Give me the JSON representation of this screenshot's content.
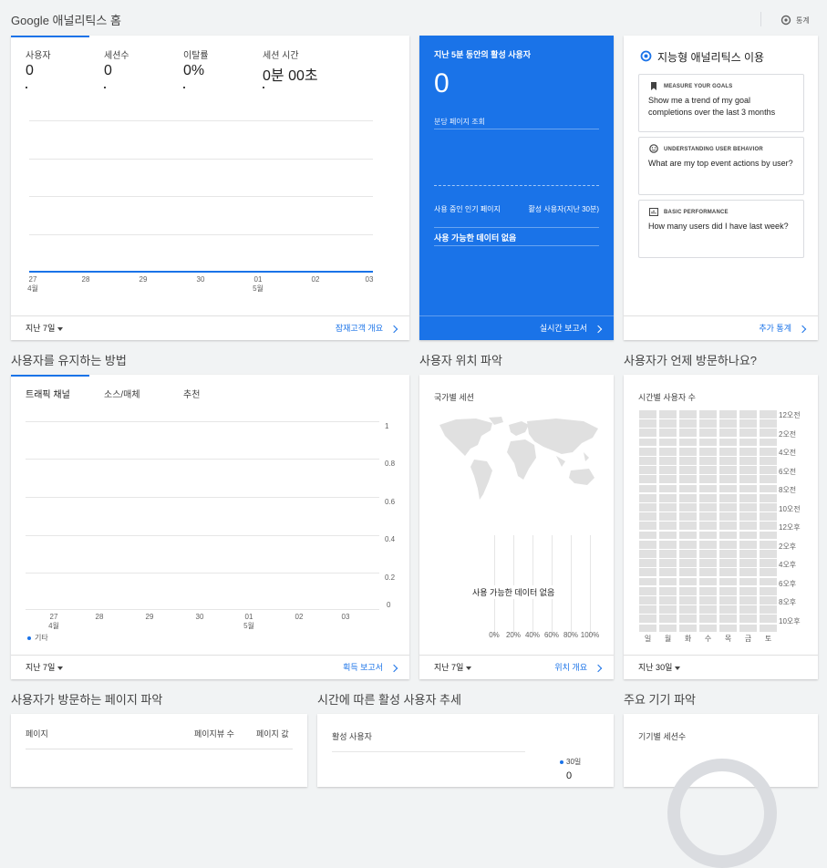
{
  "header": {
    "title": "Google 애널리틱스 홈",
    "insights_label": "통계"
  },
  "overview": {
    "metrics": [
      {
        "label": "사용자",
        "value": "0"
      },
      {
        "label": "세션수",
        "value": "0"
      },
      {
        "label": "이탈률",
        "value": "0%"
      },
      {
        "label": "세션 시간",
        "value": "0분 00초"
      }
    ],
    "x_ticks": [
      {
        "day": "27",
        "month": "4월"
      },
      {
        "day": "28",
        "month": ""
      },
      {
        "day": "29",
        "month": ""
      },
      {
        "day": "30",
        "month": ""
      },
      {
        "day": "01",
        "month": "5월"
      },
      {
        "day": "02",
        "month": ""
      },
      {
        "day": "03",
        "month": ""
      }
    ],
    "date_range": "지난 7일",
    "link": "잠재고객 개요"
  },
  "realtime": {
    "title": "지난 5분 동안의 활성 사용자",
    "value": "0",
    "pageviews_label": "분당 페이지 조회",
    "col_pages": "사용 중인 인기 페이지",
    "col_active": "활성 사용자(지난 30분)",
    "no_data": "사용 가능한 데이터 없음",
    "link": "실시간 보고서"
  },
  "intelligence": {
    "title": "지능형 애널리틱스 이용",
    "cards": [
      {
        "icon": "bookmark-icon",
        "category": "MEASURE YOUR GOALS",
        "question": "Show me a trend of my goal completions over the last 3 months"
      },
      {
        "icon": "smiley-icon",
        "category": "UNDERSTANDING USER BEHAVIOR",
        "question": "What are my top event actions by user?"
      },
      {
        "icon": "chart-box-icon",
        "category": "BASIC PERFORMANCE",
        "question": "How many users did I have last week?"
      }
    ],
    "link": "추가 통계"
  },
  "sections": {
    "retain": "사용자를 유지하는 방법",
    "location": "사용자 위치 파악",
    "when": "사용자가 언제 방문하나요?",
    "pages": "사용자가 방문하는 페이지 파악",
    "active_trend": "시간에 따른 활성 사용자 추세",
    "devices": "주요 기기 파악"
  },
  "acquisition": {
    "tabs": [
      "트래픽 채널",
      "소스/매체",
      "추천"
    ],
    "y_ticks": [
      "1",
      "0.8",
      "0.6",
      "0.4",
      "0.2",
      "0"
    ],
    "x_ticks": [
      {
        "day": "27",
        "month": "4월"
      },
      {
        "day": "28",
        "month": ""
      },
      {
        "day": "29",
        "month": ""
      },
      {
        "day": "30",
        "month": ""
      },
      {
        "day": "01",
        "month": "5월"
      },
      {
        "day": "02",
        "month": ""
      },
      {
        "day": "03",
        "month": ""
      }
    ],
    "legend": "기타",
    "date_range": "지난 7일",
    "link": "획득 보고서"
  },
  "geo": {
    "label": "국가별 세션",
    "no_data": "사용 가능한 데이터 없음",
    "pct_ticks": [
      "0%",
      "20%",
      "40%",
      "60%",
      "80%",
      "100%"
    ],
    "date_range": "지난 7일",
    "link": "위치 개요"
  },
  "time": {
    "label": "시간별 사용자 수",
    "hours": [
      "12오전",
      "2오전",
      "4오전",
      "6오전",
      "8오전",
      "10오전",
      "12오후",
      "2오후",
      "4오후",
      "6오후",
      "8오후",
      "10오후"
    ],
    "days": [
      "일",
      "월",
      "화",
      "수",
      "목",
      "금",
      "토"
    ],
    "date_range": "지난 30일"
  },
  "pages_table": {
    "col_page": "페이지",
    "col_views": "페이지뷰 수",
    "col_value": "페이지 값"
  },
  "active_users": {
    "label": "활성 사용자",
    "legend": "30일",
    "value": "0"
  },
  "devices": {
    "label": "기기별 세션수"
  },
  "colors": {
    "accent": "#1a73e8",
    "realtime_bg": "#1a73e8",
    "page_bg": "#f1f3f4",
    "heat_cell": "#e0e0e0"
  }
}
